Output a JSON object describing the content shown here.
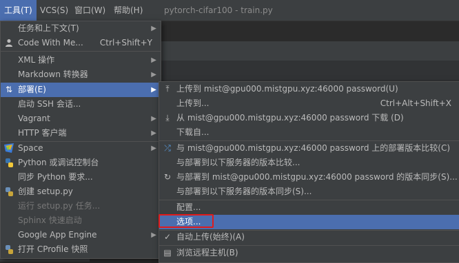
{
  "window": {
    "title": "pytorch-cifar100 - train.py"
  },
  "menubar": {
    "tools": "工具(T)",
    "vcs": "VCS(S)",
    "window": "窗口(W)",
    "help": "帮助(H)"
  },
  "tools_menu": {
    "items": [
      {
        "label": "任务和上下文(T)",
        "icon": "",
        "arrow": true
      },
      {
        "label": "Code With Me...",
        "shortcut": "Ctrl+Shift+Y",
        "icon": "person-icon"
      },
      {
        "label": "XML 操作",
        "arrow": true
      },
      {
        "label": "Markdown 转换器",
        "arrow": true
      },
      {
        "label": "部署(E)",
        "icon": "deploy-icon",
        "arrow": true,
        "selected": true
      },
      {
        "label": "启动 SSH 会话..."
      },
      {
        "label": "Vagrant",
        "arrow": true
      },
      {
        "label": "HTTP 客户端",
        "arrow": true
      },
      {
        "label": "Space",
        "icon": "space-icon",
        "arrow": true
      },
      {
        "label": "Python 或调试控制台",
        "icon": "python-icon"
      },
      {
        "label": "同步 Python 要求..."
      },
      {
        "label": "创建 setup.py",
        "icon": "setup-icon"
      },
      {
        "label": "运行 setup.py 任务...",
        "disabled": true
      },
      {
        "label": "Sphinx 快速启动",
        "disabled": true
      },
      {
        "label": "Google App Engine",
        "arrow": true
      },
      {
        "label": "打开 CProfile 快照",
        "icon": "profile-icon"
      }
    ]
  },
  "deploy_menu": {
    "items": [
      {
        "label": "上传到 mist@gpu000.mistgpu.xyz:46000 password(U)",
        "icon": "upload-icon"
      },
      {
        "label": "上传到...",
        "shortcut": "Ctrl+Alt+Shift+X"
      },
      {
        "label": "从 mist@gpu000.mistgpu.xyz:46000 password 下载 (D)",
        "icon": "download-icon"
      },
      {
        "label": "下载自..."
      },
      {
        "label": "与 mist@gpu000.mistgpu.xyz:46000 password 上的部署版本比较(C)",
        "icon": "compare-icon"
      },
      {
        "label": "与部署到以下服务器的版本比较..."
      },
      {
        "label": "与部署到 mist@gpu000.mistgpu.xyz:46000 password 的版本同步(S)...",
        "icon": "sync-icon"
      },
      {
        "label": "与部署到以下服务器的版本同步(S)..."
      },
      {
        "label": "配置..."
      },
      {
        "label": "选项...",
        "selected": true
      },
      {
        "label": "自动上传(始终)(A)",
        "icon": "check-icon"
      },
      {
        "label": "浏览远程主机(B)",
        "icon": "remote-host-icon"
      }
    ]
  },
  "colors": {
    "selection": "#4b6eaf",
    "menu_bg": "#3c3f41",
    "highlight_box": "#e01b1b"
  }
}
